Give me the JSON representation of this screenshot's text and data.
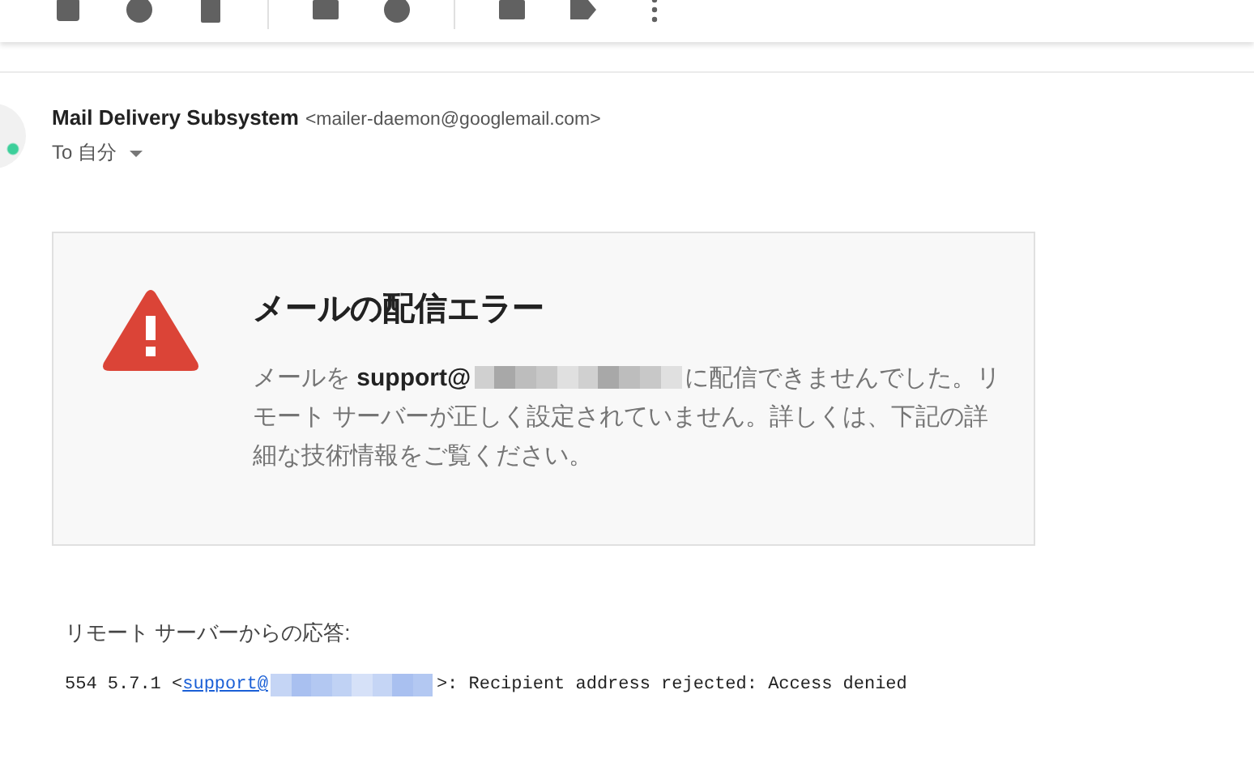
{
  "sender": {
    "name": "Mail Delivery Subsystem",
    "address": "<mailer-daemon@googlemail.com>",
    "recipient": "To 自分"
  },
  "error_card": {
    "title": "メールの配信エラー",
    "message_before": "メールを **support@**",
    "message_after": "に配信できませんでした。リモート サーバーが正しく設定されていません。詳しくは、下記の詳細な技術情報をご覧ください。"
  },
  "response": {
    "label": "リモート サーバーからの応答:",
    "code": "554 5.7.1 <",
    "link": "support@",
    "rest": ">: Recipient address rejected: Access denied"
  }
}
